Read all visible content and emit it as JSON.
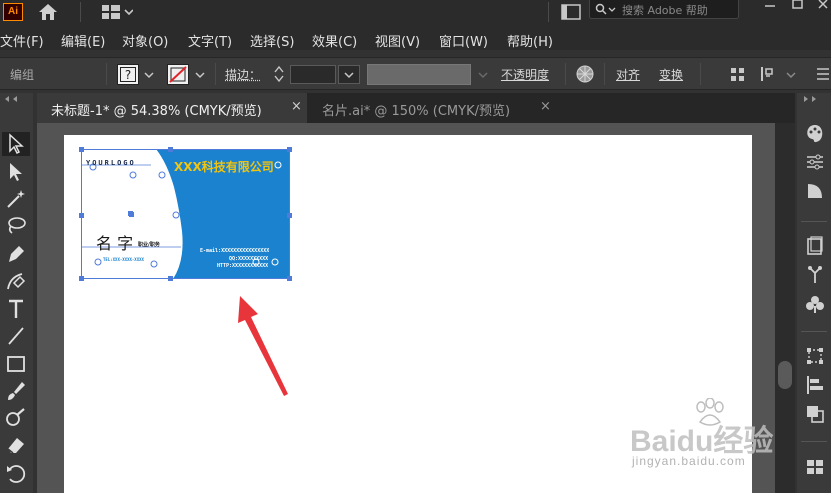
{
  "app": {
    "logo_text": "Ai"
  },
  "search": {
    "placeholder": "搜索 Adobe 帮助"
  },
  "menu": {
    "items": [
      {
        "label": "文件(F)"
      },
      {
        "label": "编辑(E)"
      },
      {
        "label": "对象(O)"
      },
      {
        "label": "文字(T)"
      },
      {
        "label": "选择(S)"
      },
      {
        "label": "效果(C)"
      },
      {
        "label": "视图(V)"
      },
      {
        "label": "窗口(W)"
      },
      {
        "label": "帮助(H)"
      }
    ]
  },
  "control_bar": {
    "group_label": "编组",
    "fill_value": "?",
    "stroke_label": "描边：",
    "opacity_label": "不透明度",
    "align_label": "对齐",
    "transform_label": "变换"
  },
  "tabs": [
    {
      "label": "未标题-1* @ 54.38% (CMYK/预览)",
      "close": "×",
      "active": true
    },
    {
      "label": "名片.ai* @ 150% (CMYK/预览)",
      "close": "×",
      "active": false
    }
  ],
  "card": {
    "logo_text": "YOURLOGO",
    "company": "XXX科技有限公司",
    "name": "名 字",
    "title_small": "职业/职务",
    "phone": "TEL:XXX-XXXX-XXXX",
    "email": "E-mail:XXXXXXXXXXXXXXXX",
    "qq": "QQ:XXXXXXXXXX",
    "web": "HTTP:XXXXXXXXXXXX",
    "colors": {
      "blue": "#1a82cf",
      "gold": "#f1c40f"
    }
  },
  "watermark": {
    "brand": "Baidu经验",
    "url": "jingyan.baidu.com"
  },
  "colors": {
    "accent_arrow": "#e8353b",
    "selection": "#4f7bd9"
  }
}
